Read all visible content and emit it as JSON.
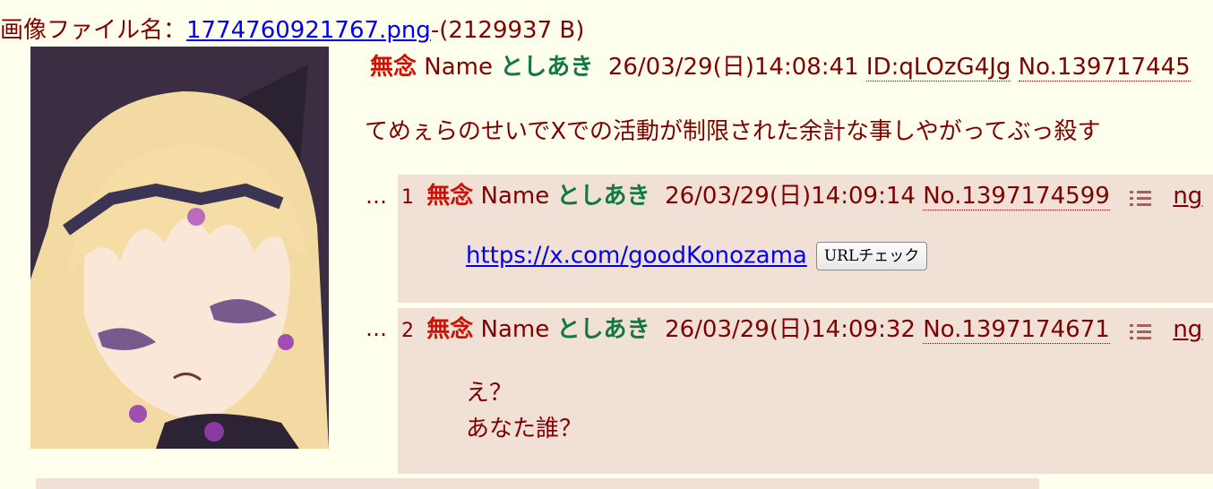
{
  "file": {
    "label": "画像ファイル名：",
    "name": "1774760921767.png",
    "size": "-(2129937 B)"
  },
  "op": {
    "subject": "無念",
    "name_label": "Name",
    "name": "としあき",
    "datetime": "26/03/29(日)14:08:41",
    "id": "ID:qLOzG4Jg",
    "number": "No.139717445",
    "body": "てめぇらのせいでXでの活動が制限された余計な事しやがってぶっ殺す"
  },
  "replies": [
    {
      "dots": "…",
      "index": "1",
      "subject": "無念",
      "name_label": "Name",
      "name": "としあき",
      "datetime": "26/03/29(日)14:09:14",
      "number": "No.1397174599",
      "ng": "ng",
      "link": "https://x.com/goodKonozama",
      "url_button": "URLチェック"
    },
    {
      "dots": "…",
      "index": "2",
      "subject": "無念",
      "name_label": "Name",
      "name": "としあき",
      "datetime": "26/03/29(日)14:09:32",
      "number": "No.1397174671",
      "ng": "ng",
      "line1": "え？",
      "line2": "あなた誰？"
    }
  ],
  "icons": {
    "menu": "menu-icon"
  },
  "colors": {
    "background": "#ffffee",
    "reply_background": "#f0e0d6",
    "subject": "#cc1105",
    "name": "#117743",
    "text": "#800000",
    "link": "#0000ee"
  }
}
